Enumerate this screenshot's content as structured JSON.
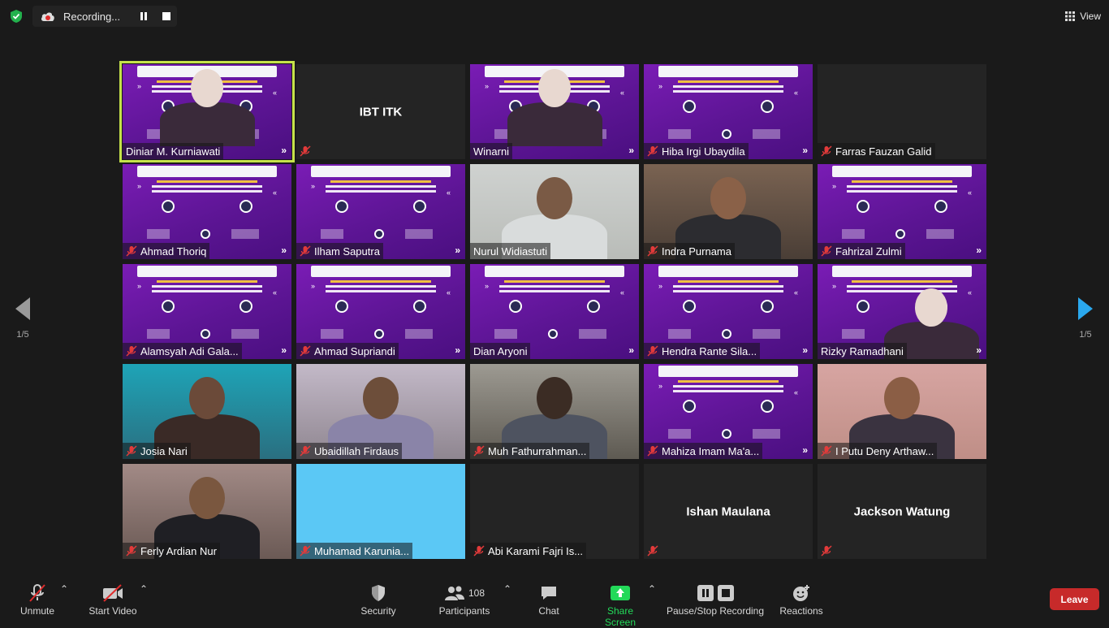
{
  "recording": {
    "label": "Recording..."
  },
  "view": {
    "label": "View"
  },
  "pagination": {
    "left": "1/5",
    "right": "1/5"
  },
  "tiles": [
    {
      "name": "Diniar M. Kurniawati",
      "muted": false,
      "kind": "slide-person",
      "active": true
    },
    {
      "name": "IBT ITK",
      "muted": true,
      "kind": "text"
    },
    {
      "name": "Winarni",
      "muted": false,
      "kind": "slide-person"
    },
    {
      "name": "Hiba Irgi Ubaydila",
      "muted": true,
      "kind": "slide"
    },
    {
      "name": "Farras Fauzan Galid",
      "muted": true,
      "kind": "blank"
    },
    {
      "name": "Ahmad Thoriq",
      "muted": true,
      "kind": "slide"
    },
    {
      "name": "Ilham Saputra",
      "muted": true,
      "kind": "slide"
    },
    {
      "name": "Nurul Widiastuti",
      "muted": false,
      "kind": "camera"
    },
    {
      "name": "Indra Purnama",
      "muted": true,
      "kind": "camera"
    },
    {
      "name": "Fahrizal Zulmi",
      "muted": true,
      "kind": "slide"
    },
    {
      "name": "Alamsyah Adi Gala...",
      "muted": true,
      "kind": "slide"
    },
    {
      "name": "Ahmad Supriandi",
      "muted": true,
      "kind": "slide"
    },
    {
      "name": "Dian Aryoni",
      "muted": false,
      "kind": "slide"
    },
    {
      "name": "Hendra Rante Sila...",
      "muted": true,
      "kind": "slide"
    },
    {
      "name": "Rizky Ramadhani",
      "muted": false,
      "kind": "slide-person"
    },
    {
      "name": "Josia Nari",
      "muted": true,
      "kind": "camera"
    },
    {
      "name": "Ubaidillah Firdaus",
      "muted": true,
      "kind": "camera"
    },
    {
      "name": "Muh Fathurrahman...",
      "muted": true,
      "kind": "camera"
    },
    {
      "name": "Mahiza Imam Ma'a...",
      "muted": true,
      "kind": "slide"
    },
    {
      "name": "I Putu Deny Arthaw...",
      "muted": true,
      "kind": "camera"
    },
    {
      "name": "Ferly Ardian Nur",
      "muted": true,
      "kind": "camera"
    },
    {
      "name": "Muhamad Karunia...",
      "muted": true,
      "kind": "color"
    },
    {
      "name": "Abi Karami Fajri Is...",
      "muted": true,
      "kind": "blank"
    },
    {
      "name": "Ishan Maulana",
      "muted": true,
      "kind": "text"
    },
    {
      "name": "Jackson Watung",
      "muted": true,
      "kind": "text"
    }
  ],
  "toolbar": {
    "unmute": "Unmute",
    "start_video": "Start Video",
    "security": "Security",
    "participants": "Participants",
    "participants_count": "108",
    "chat": "Chat",
    "share_screen": "Share Screen",
    "pause_stop": "Pause/Stop Recording",
    "reactions": "Reactions",
    "leave": "Leave"
  },
  "colors": {
    "accent_green": "#23d959",
    "leave_red": "#c72a2a",
    "active_border": "#c6e24b",
    "slide_purple": "#6a19a5"
  }
}
